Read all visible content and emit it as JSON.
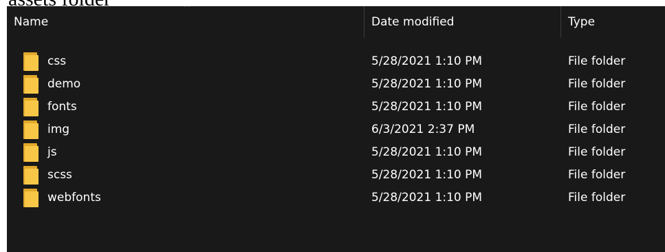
{
  "page": {
    "title": "assets folder"
  },
  "header": {
    "columns": [
      {
        "key": "name",
        "label": "Name"
      },
      {
        "key": "date",
        "label": "Date modified"
      },
      {
        "key": "type",
        "label": "Type"
      }
    ],
    "sort_indicator": "^"
  },
  "icons": {
    "row_icon": "folder-icon",
    "sort_icon": "sort-ascending-caret-icon"
  },
  "colors": {
    "background": "#191919",
    "text": "#ffffff",
    "folder_back": "#e0a82a",
    "folder_front": "#f8c748"
  },
  "rows": [
    {
      "name": "css",
      "date": "5/28/2021 1:10 PM",
      "type": "File folder"
    },
    {
      "name": "demo",
      "date": "5/28/2021 1:10 PM",
      "type": "File folder"
    },
    {
      "name": "fonts",
      "date": "5/28/2021 1:10 PM",
      "type": "File folder"
    },
    {
      "name": "img",
      "date": "6/3/2021 2:37 PM",
      "type": "File folder"
    },
    {
      "name": "js",
      "date": "5/28/2021 1:10 PM",
      "type": "File folder"
    },
    {
      "name": "scss",
      "date": "5/28/2021 1:10 PM",
      "type": "File folder"
    },
    {
      "name": "webfonts",
      "date": "5/28/2021 1:10 PM",
      "type": "File folder"
    }
  ]
}
